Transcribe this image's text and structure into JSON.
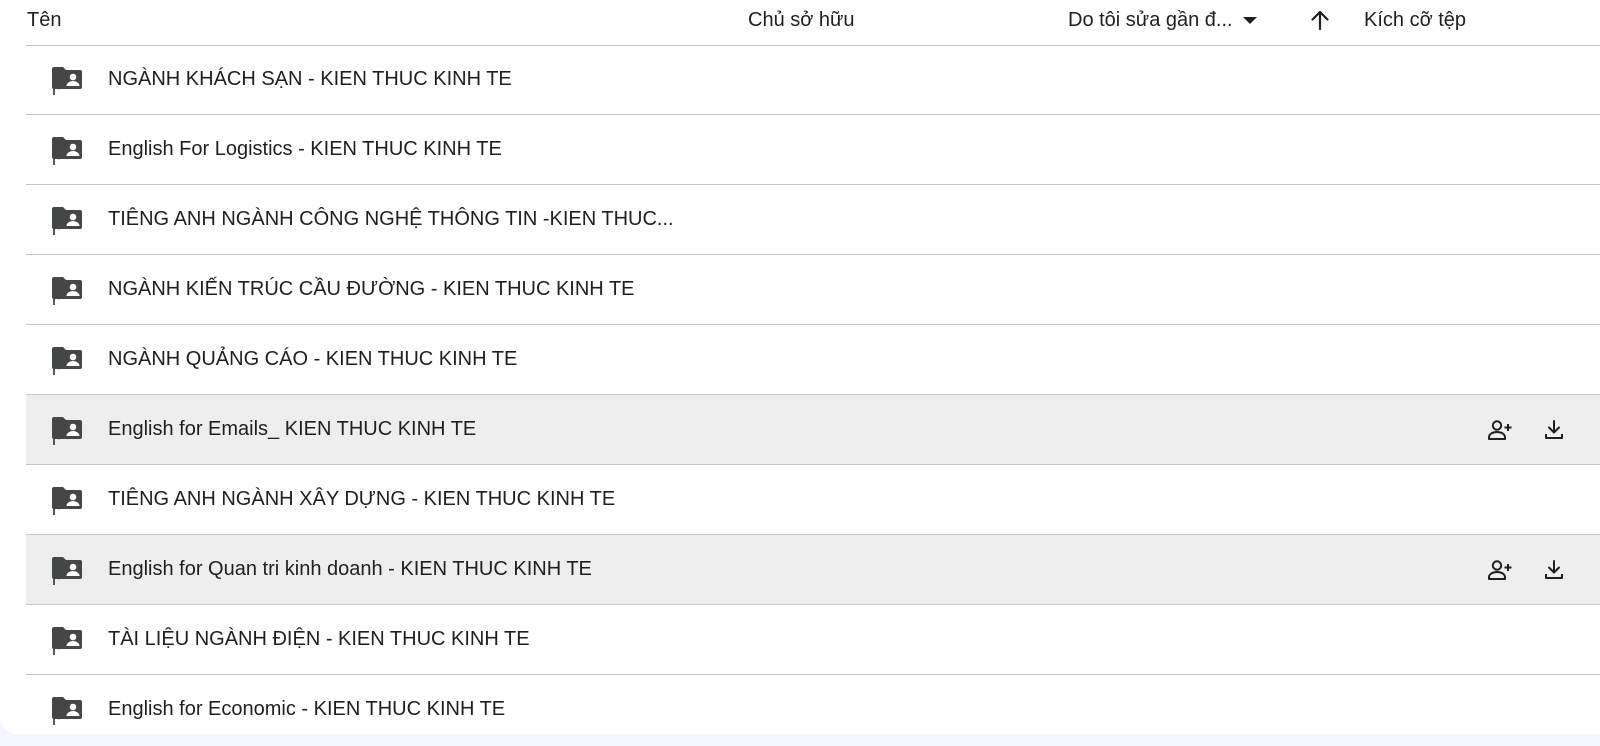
{
  "header": {
    "name": "Tên",
    "owner": "Chủ sở hữu",
    "modified": "Do tôi sửa gần đ...",
    "size": "Kích cỡ tệp"
  },
  "rows": [
    {
      "name": "NGÀNH KHÁCH SẠN - KIEN THUC KINH TE",
      "icon": "shared-folder-icon"
    },
    {
      "name": "English For Logistics - KIEN THUC KINH TE",
      "icon": "shared-folder-icon"
    },
    {
      "name": "TIÊNG ANH NGÀNH CÔNG NGHỆ THÔNG TIN -KIEN THUC...",
      "icon": "shared-folder-icon"
    },
    {
      "name": "NGÀNH KIẾN TRÚC CẦU ĐƯỜNG - KIEN THUC KINH TE",
      "icon": "shared-folder-icon"
    },
    {
      "name": "NGÀNH QUẢNG CÁO - KIEN THUC KINH TE",
      "icon": "shared-folder-icon"
    },
    {
      "name": "English for Emails_ KIEN THUC KINH TE",
      "icon": "shared-folder-icon"
    },
    {
      "name": "TIÊNG ANH NGÀNH XÂY DỰNG - KIEN THUC KINH TE",
      "icon": "shared-folder-icon"
    },
    {
      "name": "English for Quan tri kinh doanh - KIEN THUC KINH TE",
      "icon": "shared-folder-icon"
    },
    {
      "name": "TÀI LIỆU NGÀNH ĐIỆN - KIEN THUC KINH TE",
      "icon": "shared-folder-icon"
    },
    {
      "name": "English for Economic - KIEN THUC KINH TE",
      "icon": "shared-folder-icon"
    }
  ]
}
